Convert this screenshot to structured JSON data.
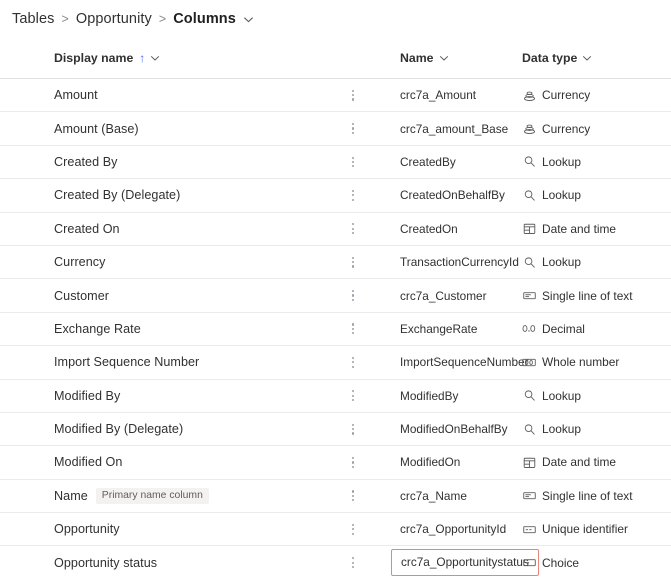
{
  "breadcrumb": {
    "items": [
      {
        "label": "Tables",
        "current": false
      },
      {
        "label": "Opportunity",
        "current": false
      },
      {
        "label": "Columns",
        "current": true
      }
    ],
    "separator": ">"
  },
  "table": {
    "headers": {
      "display_name": "Display name",
      "sort_indicator": "↑",
      "name": "Name",
      "data_type": "Data type"
    },
    "badge_primary_name": "Primary name column",
    "highlight_color": "#e8847a",
    "rows": [
      {
        "display_name": "Amount",
        "badge": null,
        "name": "crc7a_Amount",
        "data_type": "Currency",
        "icon": "currency-icon",
        "highlighted": false
      },
      {
        "display_name": "Amount (Base)",
        "badge": null,
        "name": "crc7a_amount_Base",
        "data_type": "Currency",
        "icon": "currency-icon",
        "highlighted": false
      },
      {
        "display_name": "Created By",
        "badge": null,
        "name": "CreatedBy",
        "data_type": "Lookup",
        "icon": "lookup-icon",
        "highlighted": false
      },
      {
        "display_name": "Created By (Delegate)",
        "badge": null,
        "name": "CreatedOnBehalfBy",
        "data_type": "Lookup",
        "icon": "lookup-icon",
        "highlighted": false
      },
      {
        "display_name": "Created On",
        "badge": null,
        "name": "CreatedOn",
        "data_type": "Date and time",
        "icon": "calendar-icon",
        "highlighted": false
      },
      {
        "display_name": "Currency",
        "badge": null,
        "name": "TransactionCurrencyId",
        "data_type": "Lookup",
        "icon": "lookup-icon",
        "highlighted": false
      },
      {
        "display_name": "Customer",
        "badge": null,
        "name": "crc7a_Customer",
        "data_type": "Single line of text",
        "icon": "text-box-icon",
        "highlighted": false
      },
      {
        "display_name": "Exchange Rate",
        "badge": null,
        "name": "ExchangeRate",
        "data_type": "Decimal",
        "icon": "decimal-icon",
        "highlighted": false
      },
      {
        "display_name": "Import Sequence Number",
        "badge": null,
        "name": "ImportSequenceNumber",
        "data_type": "Whole number",
        "icon": "whole-number-icon",
        "highlighted": false
      },
      {
        "display_name": "Modified By",
        "badge": null,
        "name": "ModifiedBy",
        "data_type": "Lookup",
        "icon": "lookup-icon",
        "highlighted": false
      },
      {
        "display_name": "Modified By (Delegate)",
        "badge": null,
        "name": "ModifiedOnBehalfBy",
        "data_type": "Lookup",
        "icon": "lookup-icon",
        "highlighted": false
      },
      {
        "display_name": "Modified On",
        "badge": null,
        "name": "ModifiedOn",
        "data_type": "Date and time",
        "icon": "calendar-icon",
        "highlighted": false
      },
      {
        "display_name": "Name",
        "badge": "Primary name column",
        "name": "crc7a_Name",
        "data_type": "Single line of text",
        "icon": "text-box-icon",
        "highlighted": false
      },
      {
        "display_name": "Opportunity",
        "badge": null,
        "name": "crc7a_OpportunityId",
        "data_type": "Unique identifier",
        "icon": "unique-identifier-icon",
        "highlighted": false
      },
      {
        "display_name": "Opportunity status",
        "badge": null,
        "name": "crc7a_Opportunitystatus",
        "data_type": "Choice",
        "icon": "choice-icon",
        "highlighted": true
      }
    ]
  }
}
